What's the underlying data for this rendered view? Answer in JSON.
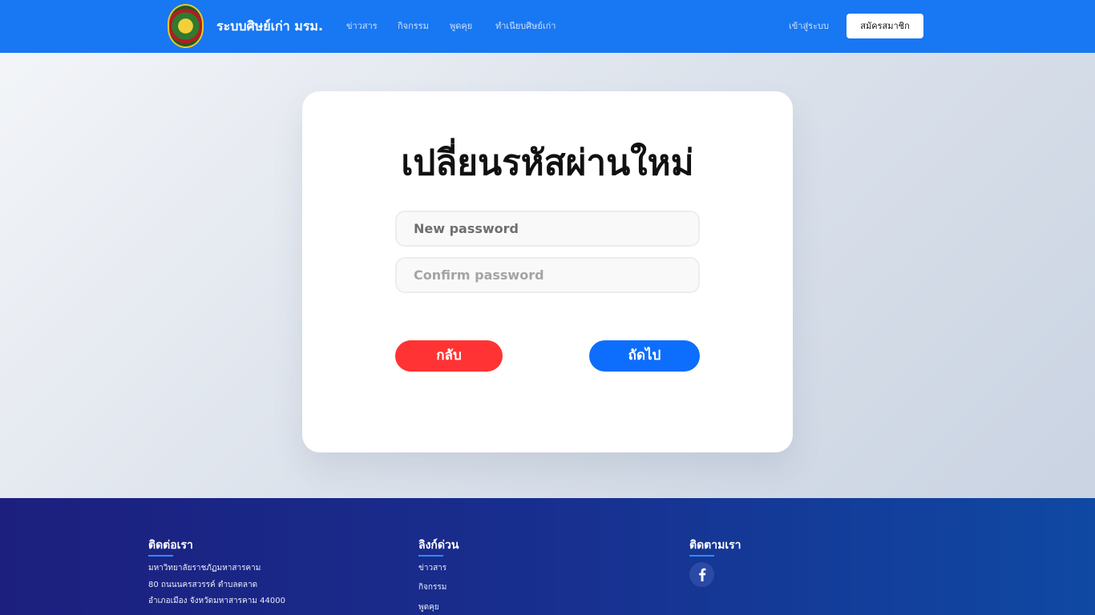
{
  "navbar": {
    "brand": "ระบบศิษย์เก่า มรม.",
    "links": [
      "ข่าวสาร",
      "กิจกรรม",
      "พูดคุย",
      "ทำเนียบศิษย์เก่า"
    ],
    "login": "เข้าสู่ระบบ",
    "register": "สมัครสมาชิก"
  },
  "form": {
    "title": "เปลี่ยนรหัสผ่านใหม่",
    "new_password_placeholder": "New password",
    "confirm_password_placeholder": "Confirm password",
    "back_button": "กลับ",
    "next_button": "ถัดไป"
  },
  "footer": {
    "contact": {
      "heading": "ติดต่อเรา",
      "lines": [
        "มหาวิทยาลัยราชภัฏมหาสารคาม",
        "80 ถนนนครสวรรค์ ตำบลตลาด",
        "อำเภอเมือง จังหวัดมหาสารคาม 44000"
      ]
    },
    "quick_links": {
      "heading": "ลิงก์ด่วน",
      "items": [
        "ข่าวสาร",
        "กิจกรรม",
        "พูดคุย"
      ]
    },
    "follow": {
      "heading": "ติดตามเรา",
      "icon": "facebook-icon"
    }
  },
  "colors": {
    "navbar": "#1877f2",
    "back_button": "#ff3333",
    "next_button": "#0d6efd",
    "footer_start": "#1c1f7e",
    "footer_end": "#0f49a3"
  }
}
